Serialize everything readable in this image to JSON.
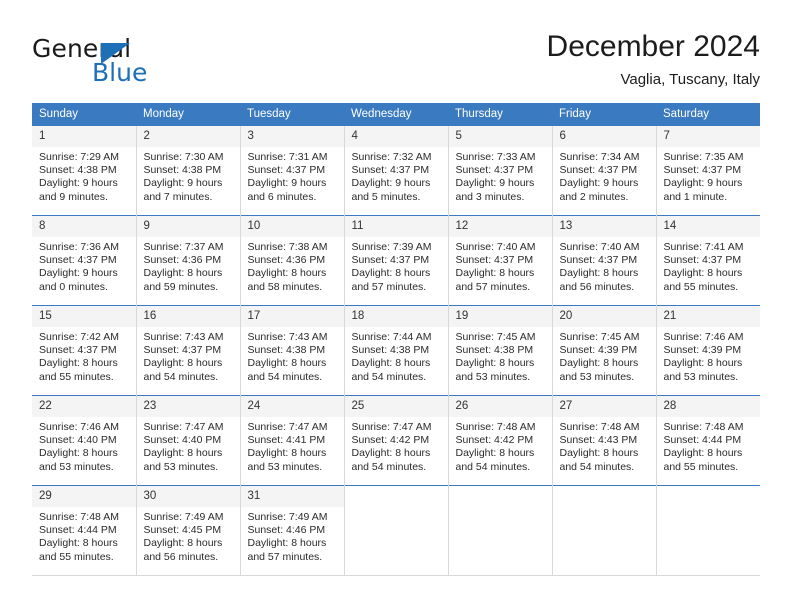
{
  "logo": {
    "word_one": "General",
    "word_two": "Blue",
    "triangle_icon": "triangle-icon",
    "brand_blue": "#1d70b8"
  },
  "header": {
    "title": "December 2024",
    "subtitle": "Vaglia, Tuscany, Italy"
  },
  "calendar": {
    "header_bg": "#3a7ac0",
    "daynum_bg": "#f4f4f4",
    "weekday_headers": [
      "Sunday",
      "Monday",
      "Tuesday",
      "Wednesday",
      "Thursday",
      "Friday",
      "Saturday"
    ],
    "weeks": [
      [
        {
          "day": "1",
          "sunrise": "Sunrise: 7:29 AM",
          "sunset": "Sunset: 4:38 PM",
          "daylight_line1": "Daylight: 9 hours",
          "daylight_line2": "and 9 minutes."
        },
        {
          "day": "2",
          "sunrise": "Sunrise: 7:30 AM",
          "sunset": "Sunset: 4:38 PM",
          "daylight_line1": "Daylight: 9 hours",
          "daylight_line2": "and 7 minutes."
        },
        {
          "day": "3",
          "sunrise": "Sunrise: 7:31 AM",
          "sunset": "Sunset: 4:37 PM",
          "daylight_line1": "Daylight: 9 hours",
          "daylight_line2": "and 6 minutes."
        },
        {
          "day": "4",
          "sunrise": "Sunrise: 7:32 AM",
          "sunset": "Sunset: 4:37 PM",
          "daylight_line1": "Daylight: 9 hours",
          "daylight_line2": "and 5 minutes."
        },
        {
          "day": "5",
          "sunrise": "Sunrise: 7:33 AM",
          "sunset": "Sunset: 4:37 PM",
          "daylight_line1": "Daylight: 9 hours",
          "daylight_line2": "and 3 minutes."
        },
        {
          "day": "6",
          "sunrise": "Sunrise: 7:34 AM",
          "sunset": "Sunset: 4:37 PM",
          "daylight_line1": "Daylight: 9 hours",
          "daylight_line2": "and 2 minutes."
        },
        {
          "day": "7",
          "sunrise": "Sunrise: 7:35 AM",
          "sunset": "Sunset: 4:37 PM",
          "daylight_line1": "Daylight: 9 hours",
          "daylight_line2": "and 1 minute."
        }
      ],
      [
        {
          "day": "8",
          "sunrise": "Sunrise: 7:36 AM",
          "sunset": "Sunset: 4:37 PM",
          "daylight_line1": "Daylight: 9 hours",
          "daylight_line2": "and 0 minutes."
        },
        {
          "day": "9",
          "sunrise": "Sunrise: 7:37 AM",
          "sunset": "Sunset: 4:36 PM",
          "daylight_line1": "Daylight: 8 hours",
          "daylight_line2": "and 59 minutes."
        },
        {
          "day": "10",
          "sunrise": "Sunrise: 7:38 AM",
          "sunset": "Sunset: 4:36 PM",
          "daylight_line1": "Daylight: 8 hours",
          "daylight_line2": "and 58 minutes."
        },
        {
          "day": "11",
          "sunrise": "Sunrise: 7:39 AM",
          "sunset": "Sunset: 4:37 PM",
          "daylight_line1": "Daylight: 8 hours",
          "daylight_line2": "and 57 minutes."
        },
        {
          "day": "12",
          "sunrise": "Sunrise: 7:40 AM",
          "sunset": "Sunset: 4:37 PM",
          "daylight_line1": "Daylight: 8 hours",
          "daylight_line2": "and 57 minutes."
        },
        {
          "day": "13",
          "sunrise": "Sunrise: 7:40 AM",
          "sunset": "Sunset: 4:37 PM",
          "daylight_line1": "Daylight: 8 hours",
          "daylight_line2": "and 56 minutes."
        },
        {
          "day": "14",
          "sunrise": "Sunrise: 7:41 AM",
          "sunset": "Sunset: 4:37 PM",
          "daylight_line1": "Daylight: 8 hours",
          "daylight_line2": "and 55 minutes."
        }
      ],
      [
        {
          "day": "15",
          "sunrise": "Sunrise: 7:42 AM",
          "sunset": "Sunset: 4:37 PM",
          "daylight_line1": "Daylight: 8 hours",
          "daylight_line2": "and 55 minutes."
        },
        {
          "day": "16",
          "sunrise": "Sunrise: 7:43 AM",
          "sunset": "Sunset: 4:37 PM",
          "daylight_line1": "Daylight: 8 hours",
          "daylight_line2": "and 54 minutes."
        },
        {
          "day": "17",
          "sunrise": "Sunrise: 7:43 AM",
          "sunset": "Sunset: 4:38 PM",
          "daylight_line1": "Daylight: 8 hours",
          "daylight_line2": "and 54 minutes."
        },
        {
          "day": "18",
          "sunrise": "Sunrise: 7:44 AM",
          "sunset": "Sunset: 4:38 PM",
          "daylight_line1": "Daylight: 8 hours",
          "daylight_line2": "and 54 minutes."
        },
        {
          "day": "19",
          "sunrise": "Sunrise: 7:45 AM",
          "sunset": "Sunset: 4:38 PM",
          "daylight_line1": "Daylight: 8 hours",
          "daylight_line2": "and 53 minutes."
        },
        {
          "day": "20",
          "sunrise": "Sunrise: 7:45 AM",
          "sunset": "Sunset: 4:39 PM",
          "daylight_line1": "Daylight: 8 hours",
          "daylight_line2": "and 53 minutes."
        },
        {
          "day": "21",
          "sunrise": "Sunrise: 7:46 AM",
          "sunset": "Sunset: 4:39 PM",
          "daylight_line1": "Daylight: 8 hours",
          "daylight_line2": "and 53 minutes."
        }
      ],
      [
        {
          "day": "22",
          "sunrise": "Sunrise: 7:46 AM",
          "sunset": "Sunset: 4:40 PM",
          "daylight_line1": "Daylight: 8 hours",
          "daylight_line2": "and 53 minutes."
        },
        {
          "day": "23",
          "sunrise": "Sunrise: 7:47 AM",
          "sunset": "Sunset: 4:40 PM",
          "daylight_line1": "Daylight: 8 hours",
          "daylight_line2": "and 53 minutes."
        },
        {
          "day": "24",
          "sunrise": "Sunrise: 7:47 AM",
          "sunset": "Sunset: 4:41 PM",
          "daylight_line1": "Daylight: 8 hours",
          "daylight_line2": "and 53 minutes."
        },
        {
          "day": "25",
          "sunrise": "Sunrise: 7:47 AM",
          "sunset": "Sunset: 4:42 PM",
          "daylight_line1": "Daylight: 8 hours",
          "daylight_line2": "and 54 minutes."
        },
        {
          "day": "26",
          "sunrise": "Sunrise: 7:48 AM",
          "sunset": "Sunset: 4:42 PM",
          "daylight_line1": "Daylight: 8 hours",
          "daylight_line2": "and 54 minutes."
        },
        {
          "day": "27",
          "sunrise": "Sunrise: 7:48 AM",
          "sunset": "Sunset: 4:43 PM",
          "daylight_line1": "Daylight: 8 hours",
          "daylight_line2": "and 54 minutes."
        },
        {
          "day": "28",
          "sunrise": "Sunrise: 7:48 AM",
          "sunset": "Sunset: 4:44 PM",
          "daylight_line1": "Daylight: 8 hours",
          "daylight_line2": "and 55 minutes."
        }
      ],
      [
        {
          "day": "29",
          "sunrise": "Sunrise: 7:48 AM",
          "sunset": "Sunset: 4:44 PM",
          "daylight_line1": "Daylight: 8 hours",
          "daylight_line2": "and 55 minutes."
        },
        {
          "day": "30",
          "sunrise": "Sunrise: 7:49 AM",
          "sunset": "Sunset: 4:45 PM",
          "daylight_line1": "Daylight: 8 hours",
          "daylight_line2": "and 56 minutes."
        },
        {
          "day": "31",
          "sunrise": "Sunrise: 7:49 AM",
          "sunset": "Sunset: 4:46 PM",
          "daylight_line1": "Daylight: 8 hours",
          "daylight_line2": "and 57 minutes."
        },
        {
          "day": "",
          "sunrise": "",
          "sunset": "",
          "daylight_line1": "",
          "daylight_line2": ""
        },
        {
          "day": "",
          "sunrise": "",
          "sunset": "",
          "daylight_line1": "",
          "daylight_line2": ""
        },
        {
          "day": "",
          "sunrise": "",
          "sunset": "",
          "daylight_line1": "",
          "daylight_line2": ""
        },
        {
          "day": "",
          "sunrise": "",
          "sunset": "",
          "daylight_line1": "",
          "daylight_line2": ""
        }
      ]
    ]
  }
}
